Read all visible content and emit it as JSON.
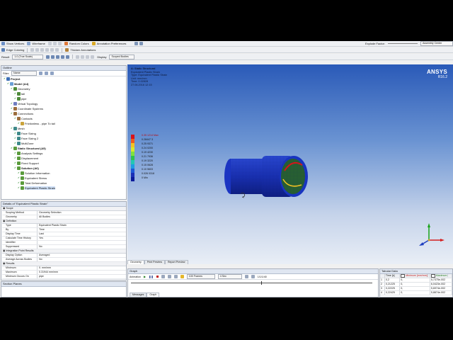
{
  "toolbar1": {
    "show_vertices": "Show Vertices",
    "wireframe": "Wireframe",
    "random_colors": "Random Colors",
    "annotation_preferences": "Annotation Preferences",
    "explode_factor": "Explode Factor:",
    "assembly_center": "Assembly Center"
  },
  "toolbar2": {
    "edge_coloring": "Edge Coloring",
    "thicken_annotations": "Thicken Annotations"
  },
  "toolbar3": {
    "result_label": "Result",
    "result_scale": "1.0 (True Scale)",
    "display_label": "Display",
    "display_value": "Scoped Bodies"
  },
  "outline": {
    "title": "Outline",
    "filter_label": "Filter:",
    "filter_value": "Name",
    "items": [
      {
        "label": "Project",
        "level": 0,
        "bold": true,
        "color": "#3d6fb6"
      },
      {
        "label": "Model (A4)",
        "level": 1,
        "bold": true,
        "color": "#6a9fd6"
      },
      {
        "label": "Geometry",
        "level": 2,
        "bold": false,
        "color": "#4f8b3a"
      },
      {
        "label": "tail",
        "level": 3,
        "bold": false,
        "color": "#4f8b3a"
      },
      {
        "label": "pipe",
        "level": 3,
        "bold": false,
        "color": "#4f8b3a"
      },
      {
        "label": "Virtual Topology",
        "level": 2,
        "bold": false,
        "color": "#6e7dbf"
      },
      {
        "label": "Coordinate Systems",
        "level": 2,
        "bold": false,
        "color": "#9b6e3c"
      },
      {
        "label": "Connections",
        "level": 2,
        "bold": false,
        "color": "#9b6e3c"
      },
      {
        "label": "Contacts",
        "level": 3,
        "bold": false,
        "color": "#9b6e3c"
      },
      {
        "label": "Frictionless - pipe To tail",
        "level": 4,
        "bold": false,
        "color": "#c9a23a"
      },
      {
        "label": "Mesh",
        "level": 2,
        "bold": false,
        "color": "#3f8a8a"
      },
      {
        "label": "Face Sizing",
        "level": 3,
        "bold": false,
        "color": "#3f8a8a"
      },
      {
        "label": "Face Sizing 2",
        "level": 3,
        "bold": false,
        "color": "#3f8a8a"
      },
      {
        "label": "MultiZone",
        "level": 3,
        "bold": false,
        "color": "#3f8a8a"
      },
      {
        "label": "Static Structural (A5)",
        "level": 2,
        "bold": true,
        "color": "#5a9b3c"
      },
      {
        "label": "Analysis Settings",
        "level": 3,
        "bold": false,
        "color": "#5a9b3c"
      },
      {
        "label": "Displacement",
        "level": 3,
        "bold": false,
        "color": "#5a9b3c"
      },
      {
        "label": "Fixed Support",
        "level": 3,
        "bold": false,
        "color": "#5a9b3c"
      },
      {
        "label": "Solution (A6)",
        "level": 3,
        "bold": true,
        "color": "#5a9b3c"
      },
      {
        "label": "Solution Information",
        "level": 4,
        "bold": false,
        "color": "#5a9b3c"
      },
      {
        "label": "Equivalent Stress",
        "level": 4,
        "bold": false,
        "color": "#5a9b3c"
      },
      {
        "label": "Total Deformation",
        "level": 4,
        "bold": false,
        "color": "#5a9b3c"
      },
      {
        "label": "Equivalent Plastic Strain",
        "level": 4,
        "bold": false,
        "color": "#5a9b3c"
      }
    ]
  },
  "details": {
    "title": "Details of \"Equivalent Plastic Strain\"",
    "rows": [
      {
        "type": "section",
        "label": "Scope"
      },
      {
        "type": "row",
        "k": "Scoping Method",
        "v": "Geometry Selection"
      },
      {
        "type": "row",
        "k": "Geometry",
        "v": "All Bodies"
      },
      {
        "type": "section",
        "label": "Definition"
      },
      {
        "type": "row",
        "k": "Type",
        "v": "Equivalent Plastic Strain"
      },
      {
        "type": "row",
        "k": "By",
        "v": "Time"
      },
      {
        "type": "row",
        "k": "Display Time",
        "v": "Last"
      },
      {
        "type": "row",
        "k": "Calculate Time History",
        "v": "Yes"
      },
      {
        "type": "row",
        "k": "Identifier",
        "v": ""
      },
      {
        "type": "row",
        "k": "Suppressed",
        "v": "No"
      },
      {
        "type": "section",
        "label": "Integration Point Results"
      },
      {
        "type": "row",
        "k": "Display Option",
        "v": "Averaged"
      },
      {
        "type": "row",
        "k": "Average Across Bodies",
        "v": "No"
      },
      {
        "type": "section",
        "label": "Results"
      },
      {
        "type": "row",
        "k": "Minimum",
        "v": "0. mm/mm"
      },
      {
        "type": "row",
        "k": "Maximum",
        "v": "0.31944 mm/mm"
      },
      {
        "type": "row",
        "k": "Minimum Occurs On",
        "v": "pipe"
      }
    ]
  },
  "section_planes": {
    "title": "Section Planes"
  },
  "viewport": {
    "tabs": [
      "Geometry",
      "Print Preview",
      "Report Preview"
    ],
    "info": {
      "title": "A: Static Structural",
      "line1": "Equivalent Plastic Strain",
      "line2": "Type: Equivalent Plastic Strain",
      "line3": "Unit: mm/mm",
      "line4": "Time: 0.02828",
      "line5": "27.06.2016 12:15"
    },
    "brand": "ANSYS",
    "version": "R16.2",
    "legend": [
      {
        "label": "0.35 1214 Max",
        "color": "#d8131b"
      },
      {
        "label": "0.28447 3",
        "color": "#f05a1c"
      },
      {
        "label": "0.25 9371",
        "color": "#f3c322"
      },
      {
        "label": "0.24 0200",
        "color": "#d8e92c"
      },
      {
        "label": "0.19 4230",
        "color": "#7fe13d"
      },
      {
        "label": "0.21 7936",
        "color": "#2fc24e"
      },
      {
        "label": "0.19 3220",
        "color": "#23c7b3"
      },
      {
        "label": "0.15 0628",
        "color": "#1e9ee2"
      },
      {
        "label": "0.10 5603",
        "color": "#1d59d6"
      },
      {
        "label": "0.026 0318",
        "color": "#1a2fb6"
      },
      {
        "label": "0 Min",
        "color": "#0b1a9a"
      }
    ]
  },
  "graph": {
    "title": "Graph",
    "animation_label": "Animation",
    "frames": "100 Frames",
    "seconds": "4 Sec",
    "counter": "1/1/1/40",
    "tabs": [
      "Messages",
      "Graph"
    ]
  },
  "tabular": {
    "title": "Tabular Data",
    "headers": [
      "Time [s]",
      "Minimum [mm/mm]",
      "Maximum"
    ],
    "rows": [
      {
        "n": "1",
        "time": "0,2",
        "min": "0,",
        "max": "5,7375e-002"
      },
      {
        "n": "2",
        "time": "0,21225",
        "min": "0,",
        "max": "6,0423e-002"
      },
      {
        "n": "3",
        "time": "0,22225",
        "min": "0,",
        "max": "5,6974e-002"
      },
      {
        "n": "4",
        "time": "0,22425",
        "min": "0,",
        "max": "5,8874e-002"
      }
    ]
  },
  "colors": {
    "title_bar": "#dfe6f1",
    "viewport_top": "#2a5ab8",
    "viewport_bottom": "#e9eef6",
    "ansys_yellow": "#f7c31b"
  }
}
